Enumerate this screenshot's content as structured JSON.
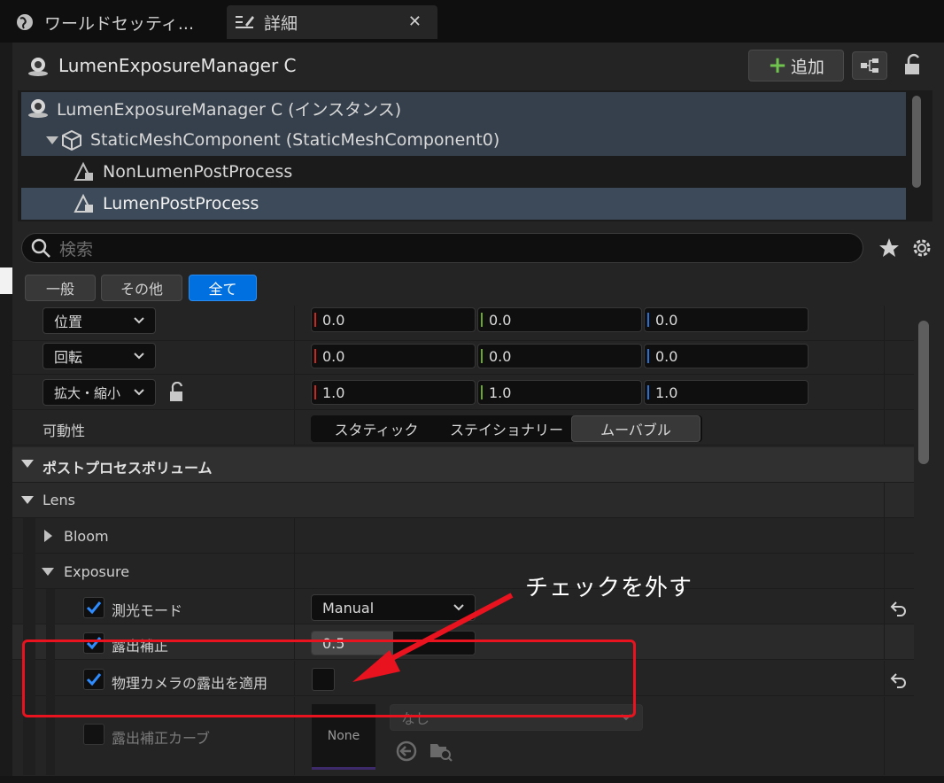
{
  "tabs": [
    {
      "label": "ワールドセッティ...",
      "icon": "globe-icon"
    },
    {
      "label": "詳細",
      "icon": "details-icon"
    }
  ],
  "actor": {
    "title": "LumenExposureManager C",
    "add_label": "追加"
  },
  "tree": {
    "items": [
      {
        "label": "LumenExposureManager C (インスタンス)"
      },
      {
        "label": "StaticMeshComponent (StaticMeshComponent0)"
      },
      {
        "label": "NonLumenPostProcess"
      },
      {
        "label": "LumenPostProcess"
      }
    ]
  },
  "search": {
    "placeholder": "検索"
  },
  "filters": [
    "一般",
    "その他",
    "全て"
  ],
  "transform": {
    "location": {
      "label": "位置",
      "x": "0.0",
      "y": "0.0",
      "z": "0.0"
    },
    "rotation": {
      "label": "回転",
      "x": "0.0",
      "y": "0.0",
      "z": "0.0"
    },
    "scale": {
      "label": "拡大・縮小",
      "x": "1.0",
      "y": "1.0",
      "z": "1.0"
    }
  },
  "mobility": {
    "label": "可動性",
    "options": [
      "スタティック",
      "ステイショナリー",
      "ムーバブル"
    ],
    "selected": "ムーバブル"
  },
  "sections": {
    "postprocess": "ポストプロセスボリューム",
    "lens": "Lens",
    "bloom": "Bloom",
    "exposure": "Exposure"
  },
  "exposure": {
    "metering_mode": {
      "label": "測光モード",
      "value": "Manual",
      "checked": true
    },
    "compensation": {
      "label": "露出補正",
      "value": "0.5",
      "checked": true
    },
    "apply_physical": {
      "label": "物理カメラの露出を適用",
      "checked": true,
      "value_checked": false
    },
    "curve": {
      "label": "露出補正カーブ",
      "checked": false,
      "thumb": "None",
      "asset": "なし"
    }
  },
  "annotation": "チェックを外す",
  "colors": {
    "accent": "#0070e0",
    "x_axis": "#c8281e",
    "y_axis": "#6aa82a",
    "z_axis": "#2a6fd0",
    "annotation_red": "#e8131e"
  }
}
